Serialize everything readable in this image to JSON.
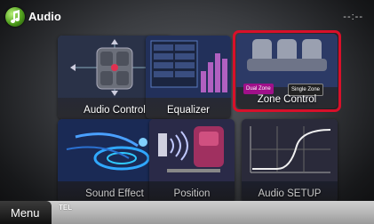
{
  "header": {
    "title": "Audio",
    "clock": "--:--"
  },
  "tiles": {
    "audio_control": {
      "label": "Audio Control"
    },
    "equalizer": {
      "label": "Equalizer"
    },
    "zone_control": {
      "label": "Zone Control",
      "dual_zone": "Dual Zone",
      "single_zone": "Single Zone"
    },
    "sound_effect": {
      "label": "Sound Effect"
    },
    "position": {
      "label": "Position"
    },
    "audio_setup": {
      "label": "Audio SETUP"
    }
  },
  "bottom_bar": {
    "menu_label": "Menu",
    "tel_label": "TEL"
  },
  "colors": {
    "highlight": "#d8102a",
    "dual_zone_active": "#a0108a"
  }
}
